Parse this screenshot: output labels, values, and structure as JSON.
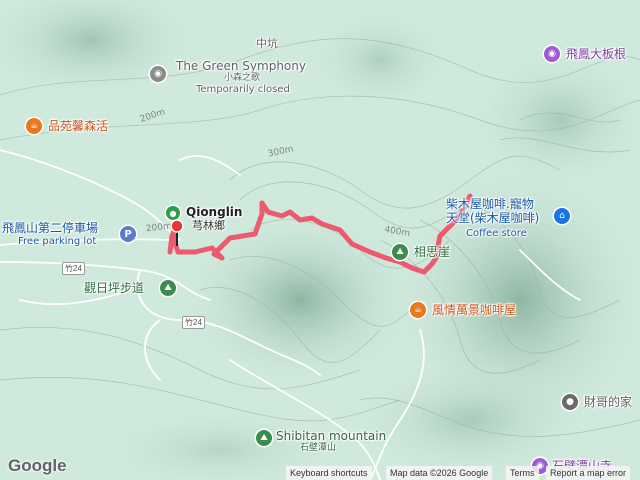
{
  "map": {
    "route_color": "#ec5a70",
    "terrain_color": "#cfe9dc",
    "start_label": "Qionglin",
    "start_label_zh": "芎林鄉"
  },
  "labels": {
    "zhongkeng": "中坑",
    "green_symphony": "The Green Symphony",
    "green_symphony_zh": "小森之歌",
    "green_symphony_status": "Temporarily closed",
    "pinyuan": "品苑馨森活",
    "feifeng_parking": "飛鳳山第二停車場",
    "free_parking": "Free parking lot",
    "guanri_trail": "觀日坪步道",
    "xiangsiyan": "相思崖",
    "fengqing": "風情萬景咖啡屋",
    "chaimuwu_1": "柴木屋咖啡.寵物",
    "chaimuwu_2": "天堂(柴木屋咖啡)",
    "coffee_store": "Coffee store",
    "feifeng_dabanggen": "飛鳳大板根",
    "caige": "財哥的家",
    "shibitan_en": "Shibitan mountain",
    "shibitan_zh": "石壁潭山",
    "bottom_right": "石壁潭山寺"
  },
  "contours": {
    "c200": "200m",
    "c300": "300m",
    "c400": "400m"
  },
  "roads": {
    "r1": "竹24",
    "r2": "竹24"
  },
  "footer": {
    "google": "Google",
    "shortcuts": "Keyboard shortcuts",
    "map_data": "Map data ©2026 Google",
    "terms": "Terms",
    "report": "Report a map error"
  },
  "icons": {
    "start_marker": "green-start-icon",
    "end_marker": "red-end-icon",
    "parking": "parking-icon",
    "trail": "hiking-icon",
    "cafe": "coffee-icon",
    "photo": "camera-icon",
    "place": "pin-icon"
  }
}
